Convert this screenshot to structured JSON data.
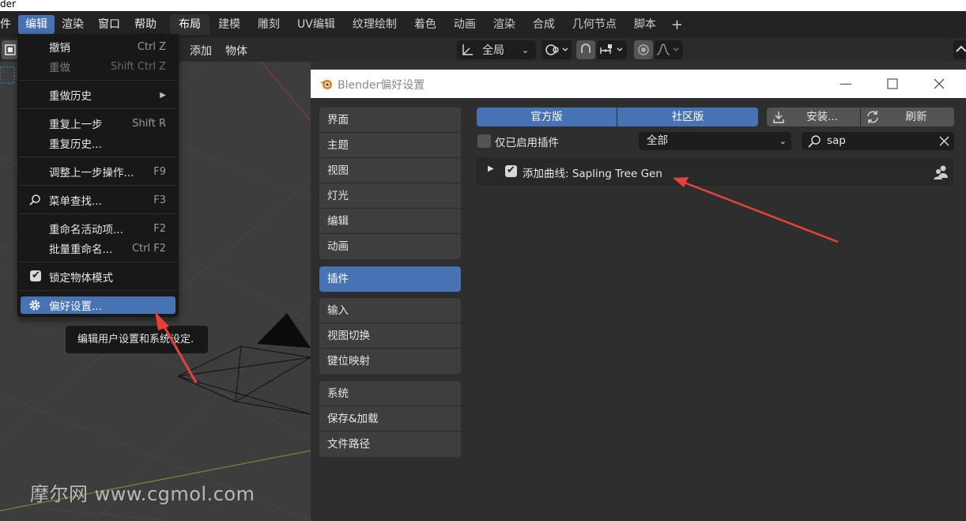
{
  "os_window_title": "der",
  "topbar": {
    "menus": [
      "件",
      "编辑",
      "渲染",
      "窗口",
      "帮助"
    ],
    "active_menu_index": 1,
    "workspaces": [
      "布局",
      "建模",
      "雕刻",
      "UV编辑",
      "纹理绘制",
      "着色",
      "动画",
      "渲染",
      "合成",
      "几何节点",
      "脚本"
    ],
    "active_workspace_index": 0,
    "add_workspace": "+"
  },
  "viewport_header": {
    "add_label": "添加",
    "object_label": "物体",
    "transform_orientation": "全局"
  },
  "edit_menu": {
    "items": [
      {
        "label": "撤销",
        "shortcut": "Ctrl Z",
        "enabled": true
      },
      {
        "label": "重做",
        "shortcut": "Shift Ctrl Z",
        "enabled": false
      },
      {
        "label": "重做历史",
        "submenu": true
      },
      {
        "label": "重复上一步",
        "shortcut": "Shift R"
      },
      {
        "label": "重复历史..."
      },
      {
        "label": "调整上一步操作...",
        "shortcut": "F9"
      },
      {
        "label": "菜单查找...",
        "shortcut": "F3"
      },
      {
        "label": "重命名活动项...",
        "shortcut": "F2"
      },
      {
        "label": "批量重命名...",
        "shortcut": "Ctrl F2"
      },
      {
        "label": "锁定物体模式",
        "checked": true
      },
      {
        "label": "偏好设置...",
        "highlighted": true
      }
    ],
    "tooltip": "编辑用户设置和系统设定."
  },
  "watermark": "摩尔网 www.cgmol.com",
  "preferences": {
    "title": "Blender偏好设置",
    "nav_groups": [
      [
        "界面",
        "主题",
        "视图",
        "灯光",
        "编辑",
        "动画"
      ],
      [
        "插件"
      ],
      [
        "输入",
        "视图切换",
        "键位映射"
      ],
      [
        "系统",
        "保存&加载",
        "文件路径"
      ]
    ],
    "active_nav": "插件",
    "tabs": {
      "official": "官方版",
      "community": "社区版"
    },
    "install_label": "安装...",
    "refresh_label": "刷新",
    "enabled_only_label": "仅已启用插件",
    "category_value": "全部",
    "search_value": "sap",
    "addon": {
      "name": "添加曲线: Sapling Tree Gen",
      "enabled": true
    }
  },
  "colors": {
    "accent": "#4772b3",
    "arrow": "#e8413a"
  }
}
